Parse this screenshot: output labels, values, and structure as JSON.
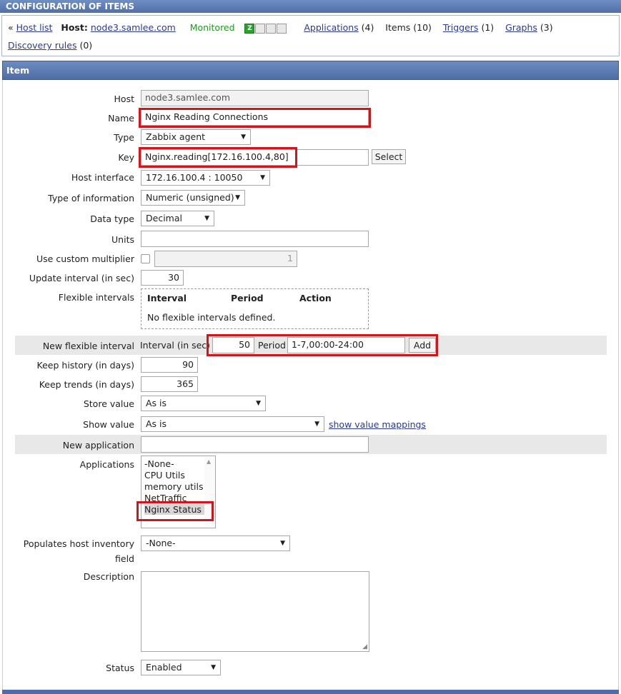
{
  "header": {
    "title": "CONFIGURATION OF ITEMS"
  },
  "nav": {
    "prefix": "«",
    "host_list": "Host list",
    "host_label": "Host:",
    "host_name": "node3.samlee.com",
    "status": "Monitored",
    "status_icons": [
      "zabbix-icon",
      "snmp-icon",
      "jmx-icon",
      "ipmi-icon"
    ],
    "status_icon_text": {
      "zbx": "Z"
    },
    "applications": "Applications",
    "applications_count": "(4)",
    "items": "Items",
    "items_count": "(10)",
    "triggers": "Triggers",
    "triggers_count": "(1)",
    "graphs": "Graphs",
    "graphs_count": "(3)",
    "discovery": "Discovery rules",
    "discovery_count": "(0)"
  },
  "section": {
    "title": "Item"
  },
  "form": {
    "host": {
      "label": "Host",
      "value": "node3.samlee.com"
    },
    "name": {
      "label": "Name",
      "value": "Nginx Reading Connections"
    },
    "type": {
      "label": "Type",
      "value": "Zabbix agent"
    },
    "key": {
      "label": "Key",
      "value": "Nginx.reading[172.16.100.4,80]",
      "select_button": "Select"
    },
    "host_interface": {
      "label": "Host interface",
      "value": "172.16.100.4 : 10050"
    },
    "type_of_information": {
      "label": "Type of information",
      "value": "Numeric (unsigned)"
    },
    "data_type": {
      "label": "Data type",
      "value": "Decimal"
    },
    "units": {
      "label": "Units",
      "value": ""
    },
    "custom_multiplier": {
      "label": "Use custom multiplier",
      "checked": false,
      "value": "1"
    },
    "update_interval": {
      "label": "Update interval (in sec)",
      "value": "30"
    },
    "flexible_intervals": {
      "label": "Flexible intervals",
      "columns": [
        "Interval",
        "Period",
        "Action"
      ],
      "empty_text": "No flexible intervals defined."
    },
    "new_flexible_interval": {
      "label": "New flexible interval",
      "interval_label": "Interval (in sec)",
      "interval_value": "50",
      "period_label": "Period",
      "period_value": "1-7,00:00-24:00",
      "add_button": "Add"
    },
    "keep_history": {
      "label": "Keep history (in days)",
      "value": "90"
    },
    "keep_trends": {
      "label": "Keep trends (in days)",
      "value": "365"
    },
    "store_value": {
      "label": "Store value",
      "value": "As is"
    },
    "show_value": {
      "label": "Show value",
      "value": "As is",
      "mappings_link": "show value mappings"
    },
    "new_application": {
      "label": "New application",
      "value": ""
    },
    "applications": {
      "label": "Applications",
      "options": [
        "-None-",
        "CPU Utils",
        "memory utils",
        "NetTraffic",
        "Nginx Status"
      ],
      "selected": "Nginx Status"
    },
    "inventory_field": {
      "label_line1": "Populates host inventory",
      "label_line2": "field",
      "value": "-None-"
    },
    "description": {
      "label": "Description",
      "value": ""
    },
    "status": {
      "label": "Status",
      "value": "Enabled"
    }
  },
  "colors": {
    "highlight": "#d0151b",
    "header_bar": "#4e6da6",
    "monitored": "#1a9c1a",
    "link": "#2b3a8f"
  }
}
